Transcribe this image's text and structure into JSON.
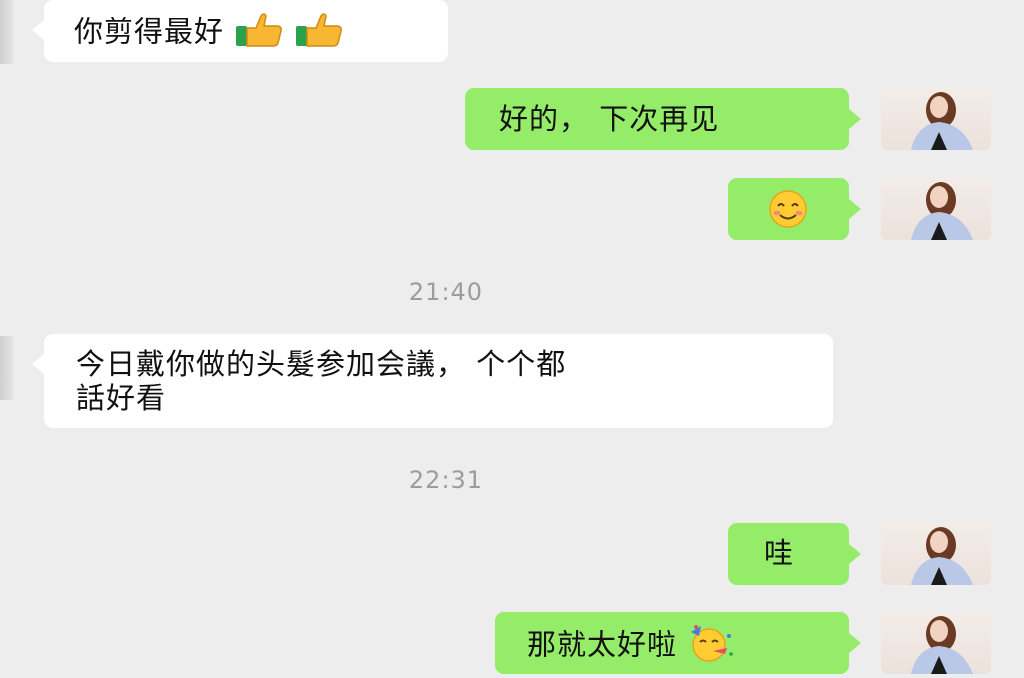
{
  "messages": [
    {
      "side": "in",
      "text": "你剪得最好",
      "emoji": [
        "thumbs-up-icon",
        "thumbs-up-icon"
      ]
    },
    {
      "side": "out",
      "text": "好的， 下次再见"
    },
    {
      "side": "out",
      "text": "",
      "emoji": [
        "smiling-face-icon"
      ]
    },
    {
      "side": "time",
      "text": "21:40"
    },
    {
      "side": "in",
      "text_line1": "今日戴你做的头髮参加会議， 个个都",
      "text_line2": "話好看"
    },
    {
      "side": "time",
      "text": "22:31"
    },
    {
      "side": "out",
      "text": "哇"
    },
    {
      "side": "out",
      "text": "那就太好啦",
      "emoji": [
        "party-face-icon"
      ]
    }
  ],
  "colors": {
    "background": "#ededed",
    "incoming_bubble": "#ffffff",
    "outgoing_bubble": "#95ec69",
    "timestamp": "#9c9c9c"
  }
}
